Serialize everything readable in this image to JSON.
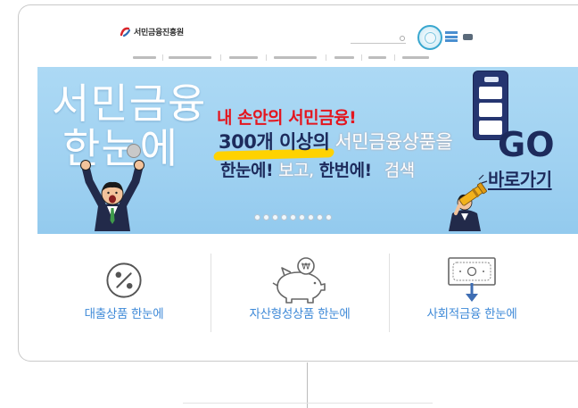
{
  "colors": {
    "card_border": "#c9c9c9",
    "banner_background": "#9fd1f1",
    "navy": "#1d2b5c",
    "tagline_red": "#e4161f",
    "highlight_yellow": "#ffd200",
    "category_label_blue": "#3f8ad8",
    "arrow_blue": "#3e6db3"
  },
  "header": {
    "logo_text": "서민금융진흥원"
  },
  "banner": {
    "headline_line1": "서민금융",
    "headline_line2": "한눈에",
    "tagline": "내 손안의 서민금융!",
    "copy_line1": [
      "300개 이상의",
      "서민금융상품을"
    ],
    "copy_line2": [
      "한눈에!",
      "보고,",
      "한번에!",
      "검색"
    ],
    "cta_main": "GO",
    "cta_sub": "바로가기",
    "slide_dots": 9
  },
  "categories": [
    {
      "label": "대출상품 한눈에",
      "icon": "percent-circle-icon"
    },
    {
      "label": "자산형성상품 한눈에",
      "icon": "piggy-bank-icon",
      "coin_symbol": "₩"
    },
    {
      "label": "사회적금융 한눈에",
      "icon": "bill-download-icon"
    }
  ]
}
